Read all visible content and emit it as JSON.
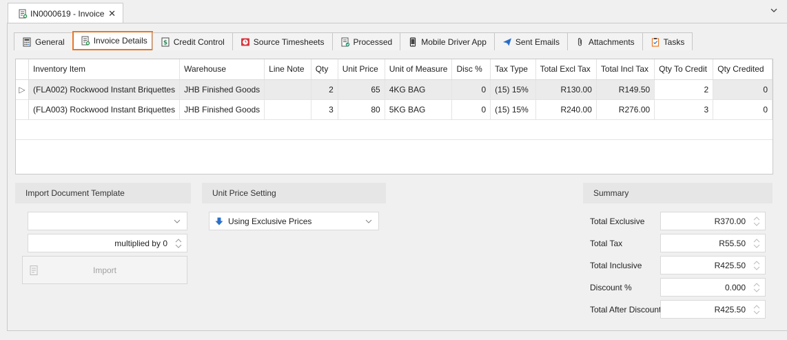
{
  "document_tab": {
    "title": "IN0000619 - Invoice",
    "close": "✕"
  },
  "tabs": [
    {
      "label": "General",
      "icon": "calculator-icon"
    },
    {
      "label": "Invoice Details",
      "icon": "document-add-icon",
      "active": true
    },
    {
      "label": "Credit Control",
      "icon": "money-icon"
    },
    {
      "label": "Source Timesheets",
      "icon": "clock-icon"
    },
    {
      "label": "Processed",
      "icon": "document-check-icon"
    },
    {
      "label": "Mobile Driver App",
      "icon": "mobile-icon"
    },
    {
      "label": "Sent Emails",
      "icon": "paper-plane-icon"
    },
    {
      "label": "Attachments",
      "icon": "paperclip-icon"
    },
    {
      "label": "Tasks",
      "icon": "clipboard-icon"
    }
  ],
  "grid": {
    "columns": [
      "Inventory Item",
      "Warehouse",
      "Line Note",
      "Qty",
      "Unit Price",
      "Unit of Measure",
      "Disc %",
      "Tax Type",
      "Total Excl Tax",
      "Total Incl Tax",
      "Qty To Credit",
      "Qty Credited"
    ],
    "rows": [
      {
        "item": "(FLA002) Rockwood Instant Briquettes",
        "warehouse": "JHB Finished Goods",
        "note": "",
        "qty": "2",
        "unit_price": "65",
        "uom": "4KG BAG",
        "disc": "0",
        "tax_type": "(15) 15%",
        "excl": "R130.00",
        "incl": "R149.50",
        "qty_to_credit": "2",
        "qty_credited": "0",
        "indicator": "▷"
      },
      {
        "item": "(FLA003) Rockwood Instant Briquettes",
        "warehouse": "JHB Finished Goods",
        "note": "",
        "qty": "3",
        "unit_price": "80",
        "uom": "5KG BAG",
        "disc": "0",
        "tax_type": "(15) 15%",
        "excl": "R240.00",
        "incl": "R276.00",
        "qty_to_credit": "3",
        "qty_credited": "0",
        "indicator": ""
      }
    ]
  },
  "import_template": {
    "title": "Import Document Template",
    "template_value": "",
    "multiplied_by": "multiplied by 0",
    "import_label": "Import"
  },
  "unit_price_setting": {
    "title": "Unit Price Setting",
    "value": "Using Exclusive Prices"
  },
  "summary": {
    "title": "Summary",
    "items": [
      {
        "label": "Total Exclusive",
        "value": "R370.00"
      },
      {
        "label": "Total Tax",
        "value": "R55.50"
      },
      {
        "label": "Total Inclusive",
        "value": "R425.50"
      },
      {
        "label": "Discount %",
        "value": "0.000"
      },
      {
        "label": "Total After Discount",
        "value": "R425.50"
      }
    ]
  },
  "colors": {
    "active_tab_border": "#e87722",
    "accent_blue": "#2a6fc9",
    "selected_row": "#ebebeb"
  }
}
